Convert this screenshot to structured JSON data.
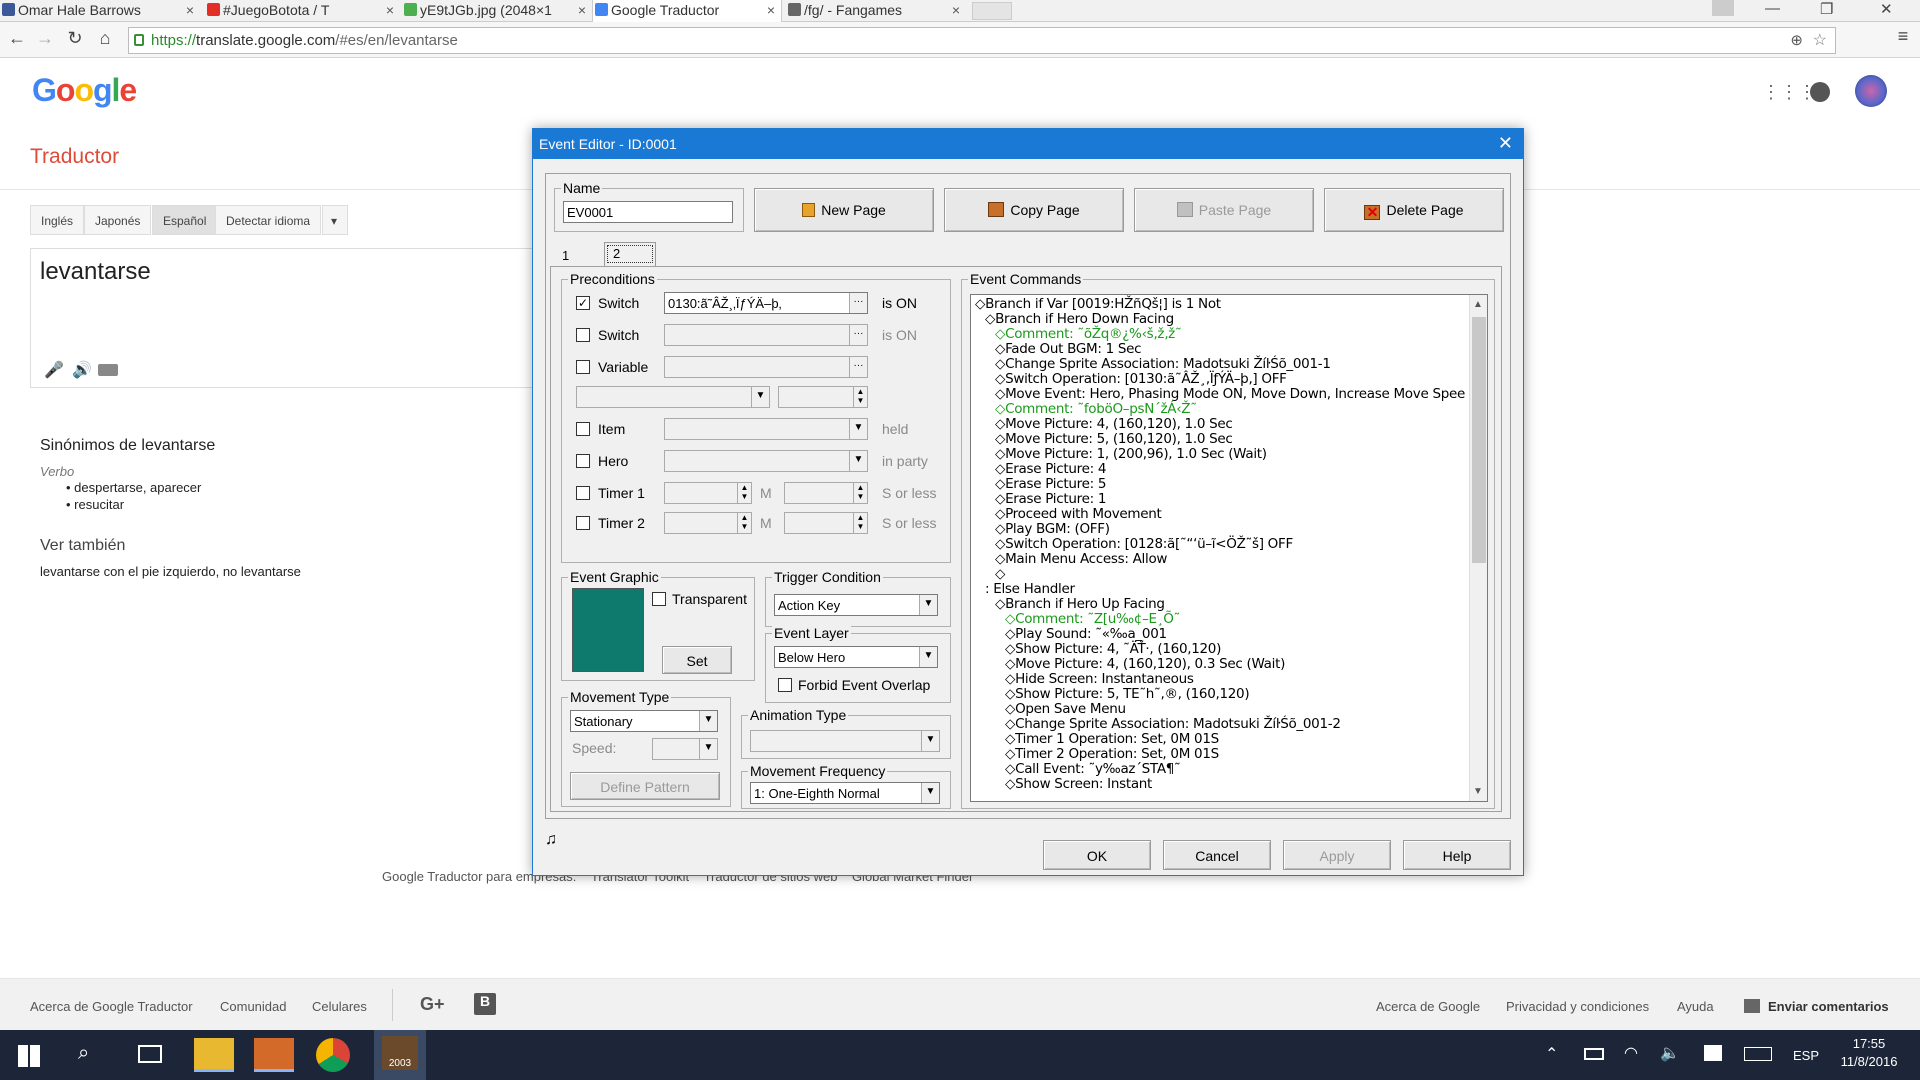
{
  "browser": {
    "tabs": [
      {
        "label": "Omar Hale Barrows",
        "color": "#3b5998"
      },
      {
        "label": "#JuegoBotota / T",
        "color": "#e52d27"
      },
      {
        "label": "yE9tJGb.jpg (2048×1",
        "color": "#4caf50"
      },
      {
        "label": "Google Traductor",
        "color": "#4285f4"
      },
      {
        "label": "/fg/ - Fangames",
        "color": "#666666"
      }
    ],
    "url_scheme": "https://",
    "url_host": "translate.google.com",
    "url_path": "/#es/en/levantarse"
  },
  "google": {
    "logo": "Google",
    "title": "Traductor",
    "lang_tabs": [
      "Inglés",
      "Japonés",
      "Español",
      "Detectar idioma"
    ],
    "source_text": "levantarse",
    "synonyms_prefix": "Sinónimos de ",
    "synonyms_word": "levantarse",
    "pos": "Verbo",
    "synonyms": [
      "despertarse, aparecer",
      "resucitar"
    ],
    "see_also_title": "Ver también",
    "see_also": "levantarse con el pie izquierdo, no levantarse",
    "business_links": [
      "Google Traductor para empresas:",
      "Translator Toolkit",
      "Traductor de sitios web",
      "Global Market Finder"
    ],
    "footer_left": [
      "Acerca de Google Traductor",
      "Comunidad",
      "Celulares"
    ],
    "footer_right": [
      "Acerca de Google",
      "Privacidad y condiciones",
      "Ayuda",
      "Enviar comentarios"
    ]
  },
  "dialog": {
    "title": "Event Editor - ID:0001",
    "name_label": "Name",
    "name_value": "EV0001",
    "buttons": {
      "new_page": "New Page",
      "copy_page": "Copy Page",
      "paste_page": "Paste Page",
      "delete_page": "Delete Page"
    },
    "page_tabs": [
      "1",
      "2"
    ],
    "preconditions": {
      "title": "Preconditions",
      "switch1_label": "Switch",
      "switch1_value": "0130:ã˜ÂŽ¸‚ÏƒÝÄ–þ‚",
      "switch1_suffix": "is ON",
      "switch2_label": "Switch",
      "switch2_suffix": "is ON",
      "variable_label": "Variable",
      "item_label": "Item",
      "item_suffix": "held",
      "hero_label": "Hero",
      "hero_suffix": "in party",
      "timer1_label": "Timer 1",
      "timer1_m": "M",
      "timer1_suffix": "S or less",
      "timer2_label": "Timer 2",
      "timer2_m": "M",
      "timer2_suffix": "S or less"
    },
    "event_graphic": {
      "title": "Event Graphic",
      "transparent": "Transparent",
      "set": "Set",
      "color": "#0e7a6e"
    },
    "trigger": {
      "title": "Trigger Condition",
      "value": "Action Key"
    },
    "layer": {
      "title": "Event Layer",
      "value": "Below Hero",
      "forbid": "Forbid Event Overlap"
    },
    "movement_type": {
      "title": "Movement Type",
      "value": "Stationary",
      "speed": "Speed:",
      "define": "Define Pattern"
    },
    "animation_type": {
      "title": "Animation Type"
    },
    "movement_freq": {
      "title": "Movement Frequency",
      "value": "1: One-Eighth Normal"
    },
    "commands_title": "Event Commands",
    "commands": [
      {
        "indent": 0,
        "text": "◇Branch if Var [0019:HŽñQš¦] is 1 Not",
        "comment": false
      },
      {
        "indent": 1,
        "text": "◇Branch if Hero Down Facing",
        "comment": false
      },
      {
        "indent": 2,
        "text": "◇Comment: ˜õŽq®¿%‹š‚ž‚ž˜",
        "comment": true
      },
      {
        "indent": 2,
        "text": "◇Fade Out BGM: 1 Sec",
        "comment": false
      },
      {
        "indent": 2,
        "text": "◇Change Sprite Association: Madotsuki ŽíŀŚõ_001-1",
        "comment": false
      },
      {
        "indent": 2,
        "text": "◇Switch Operation: [0130:ã˜ÂŽ¸‚ÏƒÝÄ–þ‚] OFF",
        "comment": false
      },
      {
        "indent": 2,
        "text": "◇Move Event: Hero, Phasing Mode ON, Move Down, Increase Move Spee",
        "comment": false
      },
      {
        "indent": 2,
        "text": "◇Comment: ˜foböO–psN´žÁ‹Ž˜",
        "comment": true
      },
      {
        "indent": 2,
        "text": "◇Move Picture: 4, (160,120), 1.0 Sec",
        "comment": false
      },
      {
        "indent": 2,
        "text": "◇Move Picture: 5, (160,120), 1.0 Sec",
        "comment": false
      },
      {
        "indent": 2,
        "text": "◇Move Picture: 1, (200,96), 1.0 Sec (Wait)",
        "comment": false
      },
      {
        "indent": 2,
        "text": "◇Erase Picture: 4",
        "comment": false
      },
      {
        "indent": 2,
        "text": "◇Erase Picture: 5",
        "comment": false
      },
      {
        "indent": 2,
        "text": "◇Erase Picture: 1",
        "comment": false
      },
      {
        "indent": 2,
        "text": "◇Proceed with Movement",
        "comment": false
      },
      {
        "indent": 2,
        "text": "◇Play BGM: (OFF)",
        "comment": false
      },
      {
        "indent": 2,
        "text": "◇Switch Operation: [0128:ã[˜“‘ü–ĩ<ÖŽ˜š] OFF",
        "comment": false
      },
      {
        "indent": 2,
        "text": "◇Main Menu Access: Allow",
        "comment": false
      },
      {
        "indent": 2,
        "text": "◇",
        "comment": false
      },
      {
        "indent": 1,
        "text": ": Else Handler",
        "comment": false
      },
      {
        "indent": 2,
        "text": "◇Branch if Hero Up Facing",
        "comment": false
      },
      {
        "indent": 3,
        "text": "◇Comment: ˜Z[u‰¢–E¸Õ˜",
        "comment": true
      },
      {
        "indent": 3,
        "text": "◇Play Sound: ˜«‰a_001",
        "comment": false
      },
      {
        "indent": 3,
        "text": "◇Show Picture: 4, ˜ÄŤ·, (160,120)",
        "comment": false
      },
      {
        "indent": 3,
        "text": "◇Move Picture: 4, (160,120), 0.3 Sec (Wait)",
        "comment": false
      },
      {
        "indent": 3,
        "text": "◇Hide Screen: Instantaneous",
        "comment": false
      },
      {
        "indent": 3,
        "text": "◇Show Picture: 5, TE˜h˜,®, (160,120)",
        "comment": false
      },
      {
        "indent": 3,
        "text": "◇Open Save Menu",
        "comment": false
      },
      {
        "indent": 3,
        "text": "◇Change Sprite Association: Madotsuki ŽíŀŚõ_001-2",
        "comment": false
      },
      {
        "indent": 3,
        "text": "◇Timer 1 Operation: Set, 0M 01S",
        "comment": false
      },
      {
        "indent": 3,
        "text": "◇Timer 2 Operation: Set, 0M 01S",
        "comment": false
      },
      {
        "indent": 3,
        "text": "◇Call Event: ˜y‰az´STA¶˜",
        "comment": false
      },
      {
        "indent": 3,
        "text": "◇Show Screen: Instant",
        "comment": false
      }
    ],
    "footer_buttons": {
      "ok": "OK",
      "cancel": "Cancel",
      "apply": "Apply",
      "help": "Help"
    }
  },
  "taskbar": {
    "lang": "ESP",
    "time": "17:55",
    "date": "11/8/2016",
    "rpg_label": "2003"
  }
}
